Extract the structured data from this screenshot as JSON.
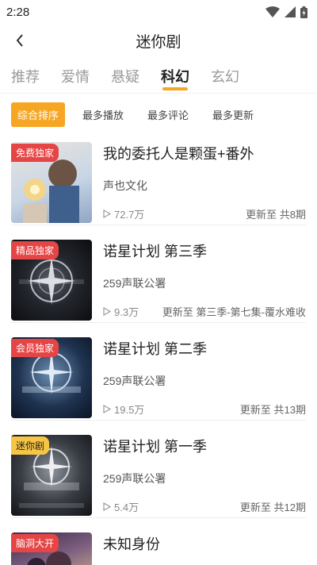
{
  "status": {
    "time": "2:28"
  },
  "header": {
    "title": "迷你剧"
  },
  "tabs": [
    {
      "label": "推荐"
    },
    {
      "label": "爱情"
    },
    {
      "label": "悬疑"
    },
    {
      "label": "科幻",
      "active": true
    },
    {
      "label": "玄幻"
    }
  ],
  "sort": [
    {
      "label": "综合排序",
      "active": true
    },
    {
      "label": "最多播放"
    },
    {
      "label": "最多评论"
    },
    {
      "label": "最多更新"
    }
  ],
  "items": [
    {
      "badge": "免费独家",
      "title": "我的委托人是颗蛋+番外",
      "author": "声也文化",
      "plays": "72.7万",
      "update": "更新至  共8期"
    },
    {
      "badge": "精品独家",
      "title": "诺星计划  第三季",
      "author": "259声联公署",
      "plays": "9.3万",
      "update": "更新至  第三季-第七集-覆水难收"
    },
    {
      "badge": "会员独家",
      "title": "诺星计划 第二季",
      "author": "259声联公署",
      "plays": "19.5万",
      "update": "更新至  共13期"
    },
    {
      "badge": "迷你剧",
      "title": "诺星计划 第一季",
      "author": "259声联公署",
      "plays": "5.4万",
      "update": "更新至  共12期"
    },
    {
      "badge": "脑洞大开",
      "title": "未知身份",
      "author": "",
      "plays": "",
      "update": ""
    }
  ],
  "colors": {
    "accent": "#f6a623",
    "badge_red": "#e64545",
    "badge_yellow": "#f7c545"
  }
}
